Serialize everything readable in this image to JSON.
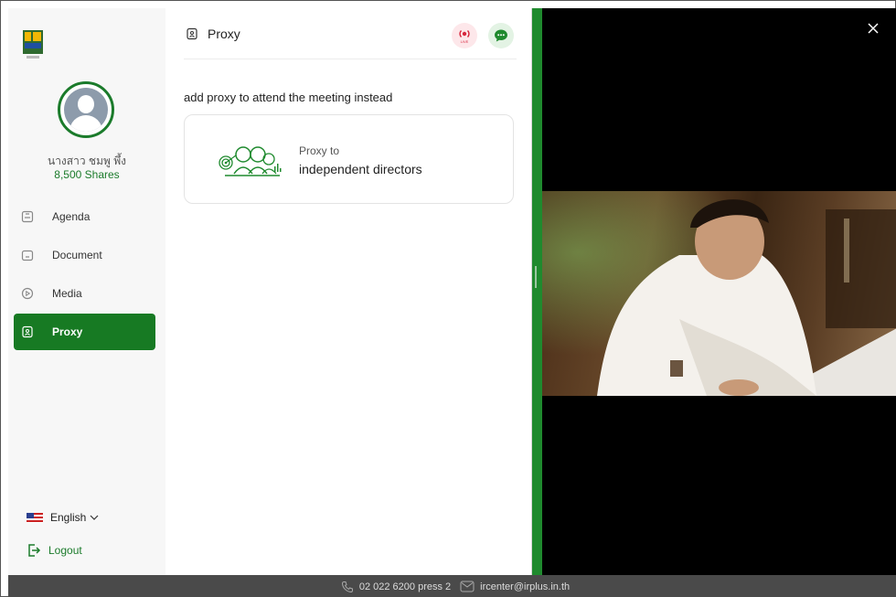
{
  "sidebar": {
    "user": {
      "name": "นางสาว ชมพู พึ้ง",
      "shares": "8,500 Shares"
    },
    "nav": [
      {
        "label": "Agenda",
        "icon": "agenda-icon"
      },
      {
        "label": "Document",
        "icon": "folder-icon"
      },
      {
        "label": "Media",
        "icon": "play-icon"
      },
      {
        "label": "Proxy",
        "icon": "proxy-icon",
        "active": true
      }
    ],
    "language": "English",
    "logout": "Logout"
  },
  "header": {
    "title": "Proxy",
    "live_badge": "LIVE"
  },
  "main": {
    "intro": "add proxy to attend the meeting instead",
    "card": {
      "small": "Proxy to",
      "big": "independent directors"
    }
  },
  "footer": {
    "phone": "02 022 6200 press 2",
    "email": "ircenter@irplus.in.th"
  },
  "colors": {
    "accent": "#177a23",
    "footer": "#4a4a4a",
    "live": "#d7263d"
  }
}
